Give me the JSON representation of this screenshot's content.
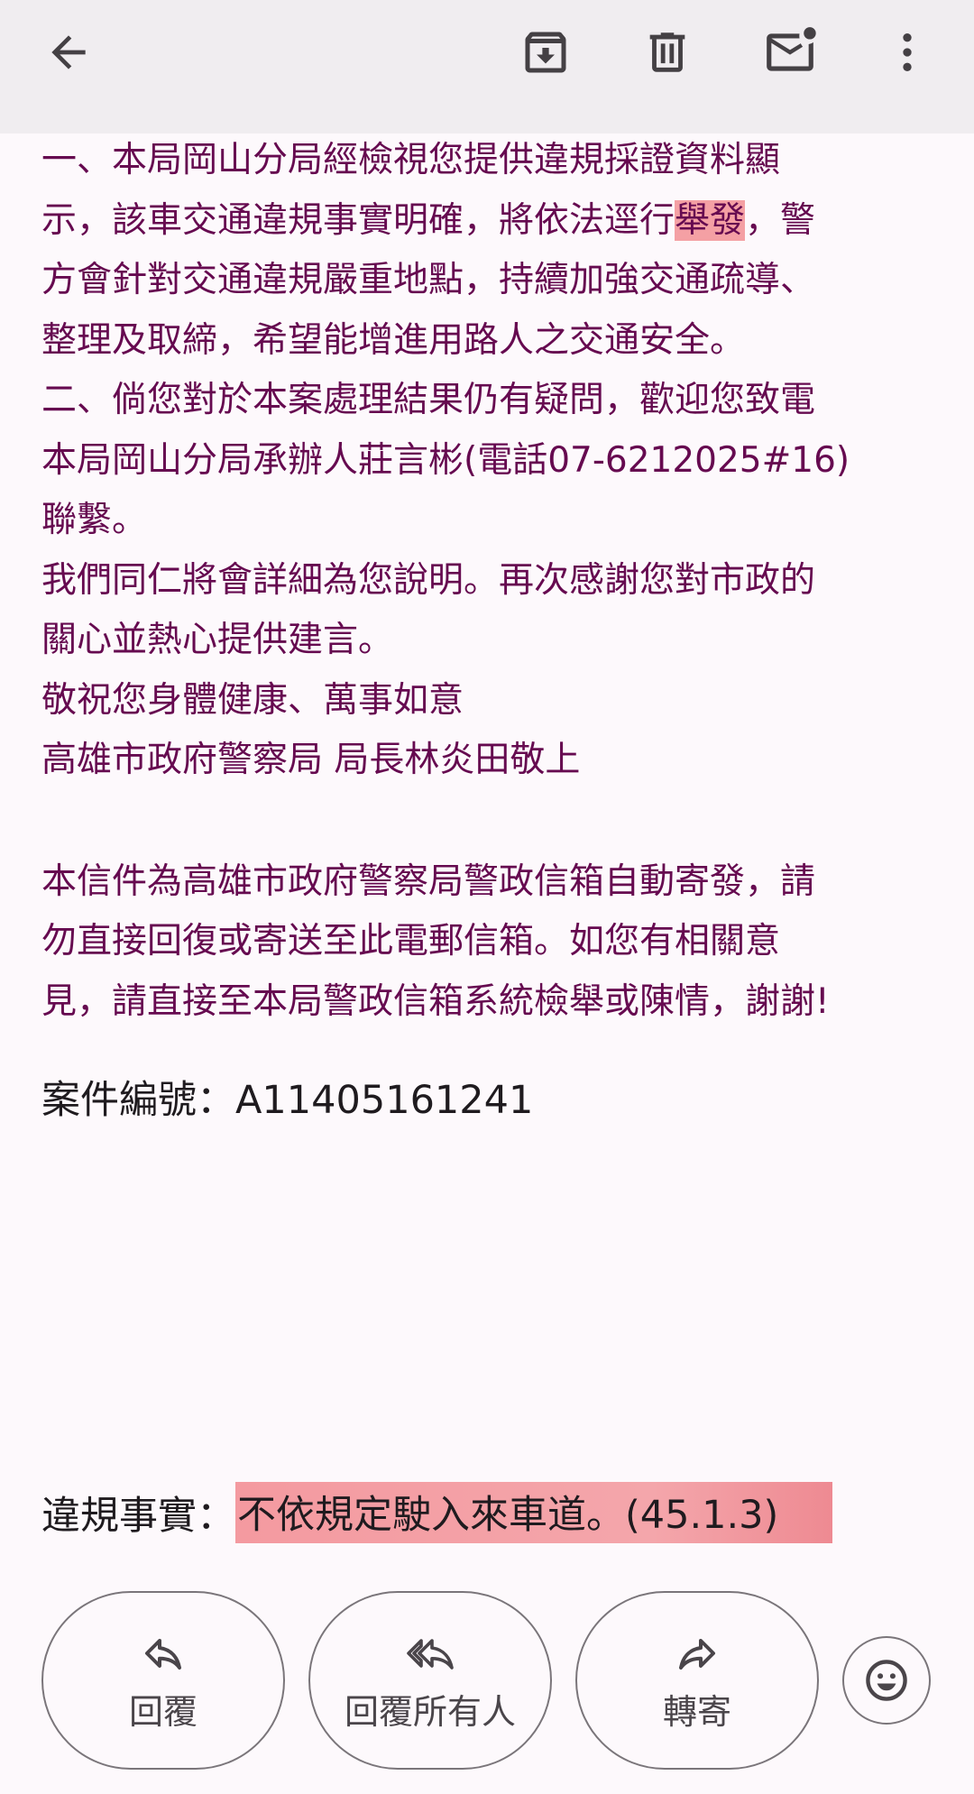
{
  "toolbar": {
    "back_icon": "arrow-back-icon",
    "archive_icon": "archive-icon",
    "delete_icon": "trash-icon",
    "mark_unread_icon": "mail-unread-icon",
    "more_icon": "more-vert-icon"
  },
  "body": {
    "lines": [
      {
        "pre": "一、本局岡山分局經檢視您提供違規採證資料顯",
        "hl": "",
        "post": ""
      },
      {
        "pre": "示，該車交通違規事實明確，將依法逕行",
        "hl": "舉發",
        "post": "，警"
      },
      {
        "pre": "方會針對交通違規嚴重地點，持續加強交通疏導、",
        "hl": "",
        "post": ""
      },
      {
        "pre": "整理及取締，希望能增進用路人之交通安全。",
        "hl": "",
        "post": ""
      },
      {
        "pre": "二、倘您對於本案處理結果仍有疑問，歡迎您致電",
        "hl": "",
        "post": ""
      },
      {
        "pre": "本局岡山分局承辦人莊言彬(電話07-6212025#16)",
        "hl": "",
        "post": ""
      },
      {
        "pre": "聯繫。",
        "hl": "",
        "post": ""
      },
      {
        "pre": "我們同仁將會詳細為您說明。再次感謝您對市政的",
        "hl": "",
        "post": ""
      },
      {
        "pre": "關心並熱心提供建言。",
        "hl": "",
        "post": ""
      },
      {
        "pre": "敬祝您身體健康、萬事如意",
        "hl": "",
        "post": ""
      },
      {
        "pre": "高雄市政府警察局 局長林炎田敬上",
        "hl": "",
        "post": ""
      }
    ],
    "notice_lines": [
      "本信件為高雄市政府警察局警政信箱自動寄發，請",
      "勿直接回復或寄送至此電郵信箱。如您有相關意",
      "見，請直接至本局警政信箱系統檢舉或陳情，謝謝!"
    ],
    "case_label": "案件編號：",
    "case_number": "A11405161241",
    "violation_label": "違規事實：",
    "violation_text": "不依規定駛入來車道。(45.1.3)"
  },
  "actions": {
    "reply_label": "回覆",
    "reply_icon": "reply-icon",
    "reply_all_label": "回覆所有人",
    "reply_all_icon": "reply-all-icon",
    "forward_label": "轉寄",
    "forward_icon": "forward-icon",
    "emoji_icon": "emoji-smile-icon"
  },
  "colors": {
    "body_text": "#660a50",
    "highlight": "#f4a0a4",
    "toolbar_bg": "#f0edf0",
    "page_bg": "#fdf9fc"
  }
}
